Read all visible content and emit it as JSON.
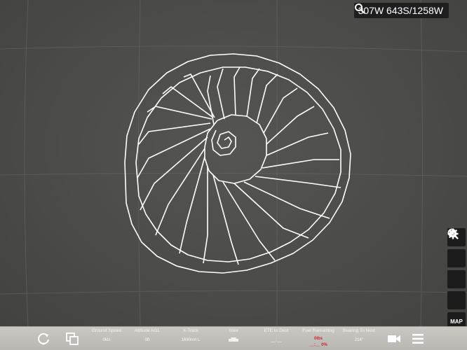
{
  "search": {
    "text": "307W 643S/1258W"
  },
  "tools": {
    "map_label": "MAP"
  },
  "stats": [
    {
      "label": "Ground Speed",
      "value": "0kts"
    },
    {
      "label": "Altitude AGL",
      "value": "0ft"
    },
    {
      "label": "X-Track",
      "value": "1690nm L"
    },
    {
      "label": "Yoke",
      "value": ""
    },
    {
      "label": "ETE to Dest",
      "value": "__:__"
    },
    {
      "label": "Fuel Remaining",
      "value": "0lbs",
      "value2": "__:__ 0%"
    },
    {
      "label": "Bearing To Next",
      "value": "214°"
    }
  ],
  "colors": {
    "map_background": "#4b4b48",
    "drawing_stroke": "#ffffff",
    "bottom_bar": "#c0bfba",
    "fuel_warning": "#d0232b"
  }
}
